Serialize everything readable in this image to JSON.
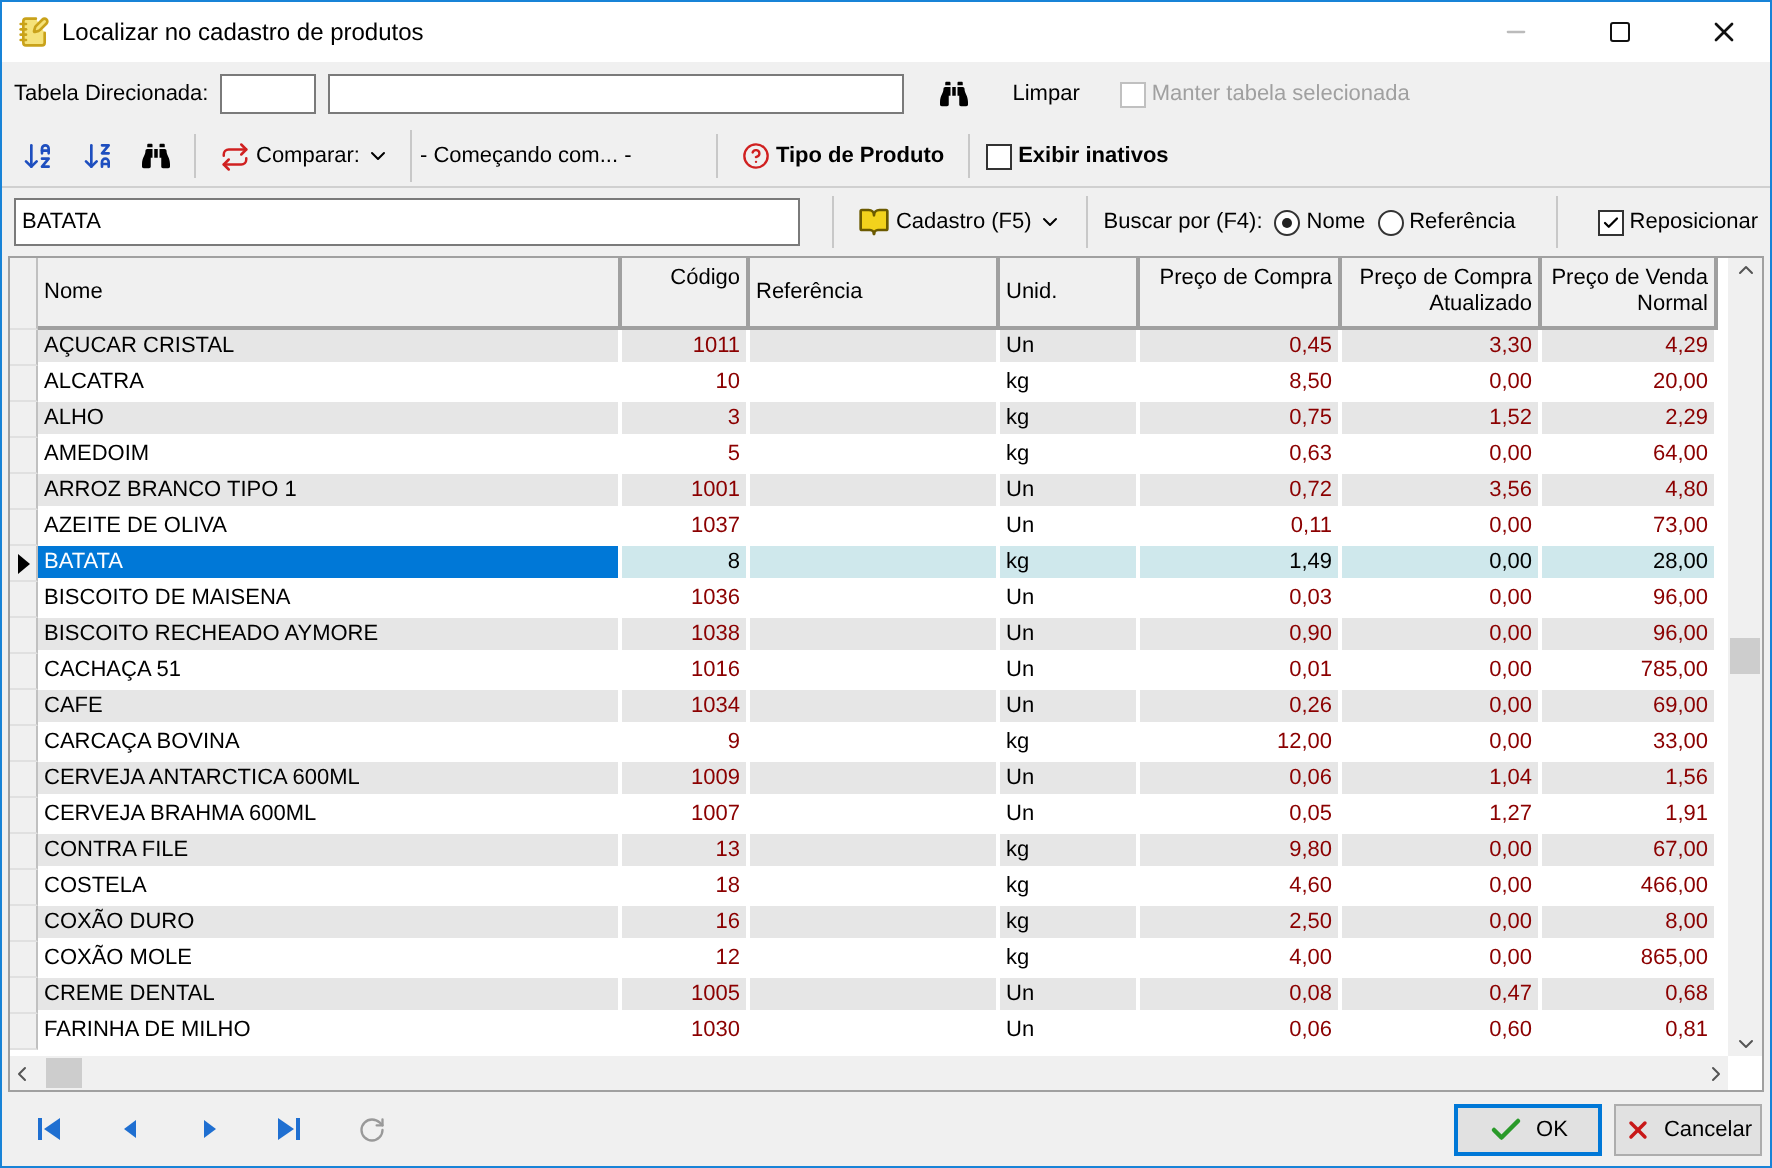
{
  "window": {
    "title": "Localizar no cadastro de produtos"
  },
  "filter_bar": {
    "label": "Tabela Direcionada:",
    "clear_label": "Limpar",
    "keep_table": {
      "label": "Manter tabela selecionada",
      "checked": false,
      "disabled": true
    }
  },
  "toolbar": {
    "compare_label": "Comparar:",
    "compare_mode": "- Começando com... -",
    "product_type_label": "Tipo de Produto",
    "show_inactive": {
      "label": "Exibir inativos",
      "checked": false
    }
  },
  "search_bar": {
    "value": "BATATA",
    "register_label": "Cadastro (F5)",
    "search_by_label": "Buscar por (F4):",
    "options": [
      {
        "label": "Nome",
        "selected": true
      },
      {
        "label": "Referência",
        "selected": false
      }
    ],
    "reposition": {
      "label": "Reposicionar",
      "checked": true
    }
  },
  "table": {
    "columns": [
      "Nome",
      "Código",
      "Referência",
      "Unid.",
      "Preço de Compra",
      "Preço de Compra Atualizado",
      "Preço de Venda Normal"
    ],
    "rows": [
      {
        "nome": "AÇUCAR CRISTAL",
        "codigo": "1011",
        "unid": "Un",
        "compra": "0,45",
        "atualizado": "3,30",
        "venda": "4,29",
        "selected": false
      },
      {
        "nome": "ALCATRA",
        "codigo": "10",
        "unid": "kg",
        "compra": "8,50",
        "atualizado": "0,00",
        "venda": "20,00",
        "selected": false
      },
      {
        "nome": "ALHO",
        "codigo": "3",
        "unid": "kg",
        "compra": "0,75",
        "atualizado": "1,52",
        "venda": "2,29",
        "selected": false
      },
      {
        "nome": "AMEDOIM",
        "codigo": "5",
        "unid": "kg",
        "compra": "0,63",
        "atualizado": "0,00",
        "venda": "64,00",
        "selected": false
      },
      {
        "nome": "ARROZ BRANCO TIPO 1",
        "codigo": "1001",
        "unid": "Un",
        "compra": "0,72",
        "atualizado": "3,56",
        "venda": "4,80",
        "selected": false
      },
      {
        "nome": "AZEITE DE OLIVA",
        "codigo": "1037",
        "unid": "Un",
        "compra": "0,11",
        "atualizado": "0,00",
        "venda": "73,00",
        "selected": false
      },
      {
        "nome": "BATATA",
        "codigo": "8",
        "unid": "kg",
        "compra": "1,49",
        "atualizado": "0,00",
        "venda": "28,00",
        "selected": true
      },
      {
        "nome": "BISCOITO DE MAISENA",
        "codigo": "1036",
        "unid": "Un",
        "compra": "0,03",
        "atualizado": "0,00",
        "venda": "96,00",
        "selected": false
      },
      {
        "nome": "BISCOITO RECHEADO AYMORE",
        "codigo": "1038",
        "unid": "Un",
        "compra": "0,90",
        "atualizado": "0,00",
        "venda": "96,00",
        "selected": false
      },
      {
        "nome": "CACHAÇA 51",
        "codigo": "1016",
        "unid": "Un",
        "compra": "0,01",
        "atualizado": "0,00",
        "venda": "785,00",
        "selected": false
      },
      {
        "nome": "CAFE",
        "codigo": "1034",
        "unid": "Un",
        "compra": "0,26",
        "atualizado": "0,00",
        "venda": "69,00",
        "selected": false
      },
      {
        "nome": "CARCAÇA BOVINA",
        "codigo": "9",
        "unid": "kg",
        "compra": "12,00",
        "atualizado": "0,00",
        "venda": "33,00",
        "selected": false
      },
      {
        "nome": "CERVEJA ANTARCTICA 600ML",
        "codigo": "1009",
        "unid": "Un",
        "compra": "0,06",
        "atualizado": "1,04",
        "venda": "1,56",
        "selected": false
      },
      {
        "nome": "CERVEJA BRAHMA 600ML",
        "codigo": "1007",
        "unid": "Un",
        "compra": "0,05",
        "atualizado": "1,27",
        "venda": "1,91",
        "selected": false
      },
      {
        "nome": "CONTRA FILE",
        "codigo": "13",
        "unid": "kg",
        "compra": "9,80",
        "atualizado": "0,00",
        "venda": "67,00",
        "selected": false
      },
      {
        "nome": "COSTELA",
        "codigo": "18",
        "unid": "kg",
        "compra": "4,60",
        "atualizado": "0,00",
        "venda": "466,00",
        "selected": false
      },
      {
        "nome": "COXÃO DURO",
        "codigo": "16",
        "unid": "kg",
        "compra": "2,50",
        "atualizado": "0,00",
        "venda": "8,00",
        "selected": false
      },
      {
        "nome": "COXÃO MOLE",
        "codigo": "12",
        "unid": "kg",
        "compra": "4,00",
        "atualizado": "0,00",
        "venda": "865,00",
        "selected": false
      },
      {
        "nome": "CREME DENTAL",
        "codigo": "1005",
        "unid": "Un",
        "compra": "0,08",
        "atualizado": "0,47",
        "venda": "0,68",
        "selected": false
      },
      {
        "nome": "FARINHA DE MILHO",
        "codigo": "1030",
        "unid": "Un",
        "compra": "0,06",
        "atualizado": "0,60",
        "venda": "0,81",
        "selected": false
      }
    ]
  },
  "buttons": [
    {
      "kind": "ok",
      "label": "OK",
      "default": true
    },
    {
      "kind": "cancel",
      "label": "Cancelar",
      "default": false
    }
  ]
}
